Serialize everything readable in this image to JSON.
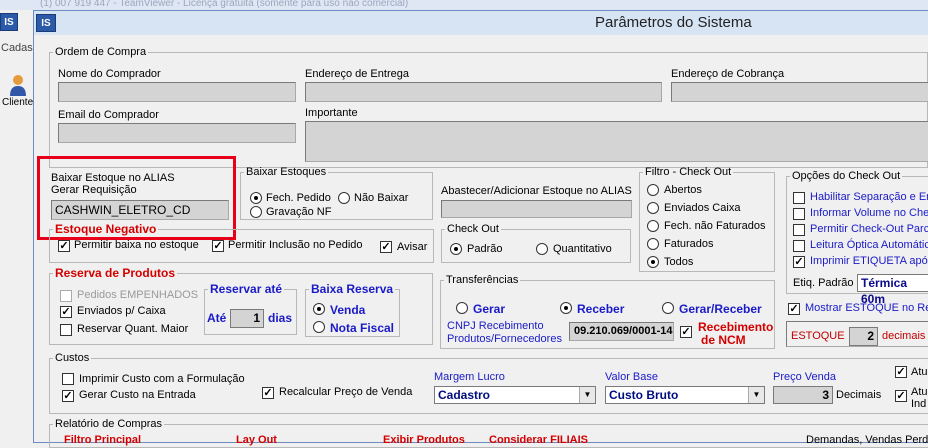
{
  "bg_window": {
    "title": "(1) 007 919 447 - TeamViewer - Licença gratuita (somente para uso não comercial)",
    "logo": "IS",
    "side_text": "Cadas",
    "side_item": "Cliente"
  },
  "dialog": {
    "logo": "IS",
    "title": "Parâmetros do Sistema"
  },
  "ordem_compra": {
    "legend": "Ordem de Compra",
    "nome_comprador": "Nome do Comprador",
    "endereco_entrega": "Endereço de Entrega",
    "endereco_cobranca": "Endereço de Cobrança",
    "email_comprador": "Email do Comprador",
    "importante": "Importante"
  },
  "alias": {
    "line1": "Baixar Estoque no ALIAS",
    "line2": "Gerar Requisição",
    "value": "CASHWIN_ELETRO_CD"
  },
  "baixar_estoques": {
    "legend": "Baixar Estoques",
    "fech_pedido": "Fech. Pedido",
    "nao_baixar": "Não Baixar",
    "gravacao_nf": "Gravação NF"
  },
  "abastecer": {
    "label": "Abastecer/Adicionar  Estoque no ALIAS"
  },
  "estoque_negativo": {
    "legend": "Estoque Negativo",
    "permitir_baixa": "Permitir baixa no estoque",
    "permitir_inclusao": "Permitir Inclusão no Pedido",
    "avisar": "Avisar"
  },
  "check_out": {
    "legend": "Check Out",
    "padrao": "Padrão",
    "quantitativo": "Quantitativo"
  },
  "filtro_checkout": {
    "legend": "Filtro - Check Out",
    "items": [
      "Abertos",
      "Enviados Caixa",
      "Fech. não Faturados",
      "Faturados",
      "Todos"
    ]
  },
  "opcoes_checkout": {
    "legend": "Opções do Check Out",
    "items": [
      "Habilitar Separação e Em",
      "Informar Volume no Chec",
      "Permitir Check-Out Parcia",
      "Leitura Óptica Automátic",
      "Imprimir ETIQUETA após"
    ],
    "etiq_label": "Etiq. Padrão",
    "etiq_value": "Térmica 60m"
  },
  "reserva": {
    "legend": "Reserva de Produtos",
    "pedidos_empenhados": "Pedidos EMPENHADOS",
    "enviados_caixa": "Enviados p/ Caixa",
    "reservar_quant": "Reservar Quant. Maior",
    "reservar_ate_legend": "Reservar até",
    "ate": "Até",
    "dias_value": "1",
    "dias": "dias",
    "baixa_reserva_legend": "Baixa Reserva",
    "venda": "Venda",
    "nota_fiscal": "Nota Fiscal"
  },
  "transferencias": {
    "legend": "Transferências",
    "gerar": "Gerar",
    "receber": "Receber",
    "gerar_receber": "Gerar/Receber",
    "cnpj_label1": "CNPJ Recebimento",
    "cnpj_label2": "Produtos/Fornecedores",
    "cnpj_value": "09.210.069/0001-14",
    "receb_ncm1": "Recebimento",
    "receb_ncm2": "de NCM"
  },
  "mostrar_estoque": {
    "label": "Mostrar ESTOQUE no Re",
    "estoque_label": "ESTOQUE",
    "estoque_value": "2",
    "decimais": "decimais"
  },
  "custos": {
    "legend": "Custos",
    "imprimir_custo": "Imprimir Custo com a Formulação",
    "gerar_custo": "Gerar Custo na Entrada",
    "recalcular": "Recalcular Preço de Venda",
    "margem_label": "Margem Lucro",
    "margem_value": "Cadastro",
    "valor_base_label": "Valor Base",
    "valor_base_value": "Custo Bruto",
    "preco_venda_label": "Preço Venda",
    "preco_venda_value": "3",
    "decimais": "Decimais",
    "atu1": "Atu",
    "atu2": "Atu",
    "ind": "Ind"
  },
  "relatorio": {
    "legend": "Relatório de Compras",
    "filtro": "Filtro Principal",
    "lay_out": "Lay Out",
    "exibir": "Exibir Produtos",
    "considerar": "Considerar FILIAIS",
    "demandas": "Demandas, Vendas Perd"
  }
}
